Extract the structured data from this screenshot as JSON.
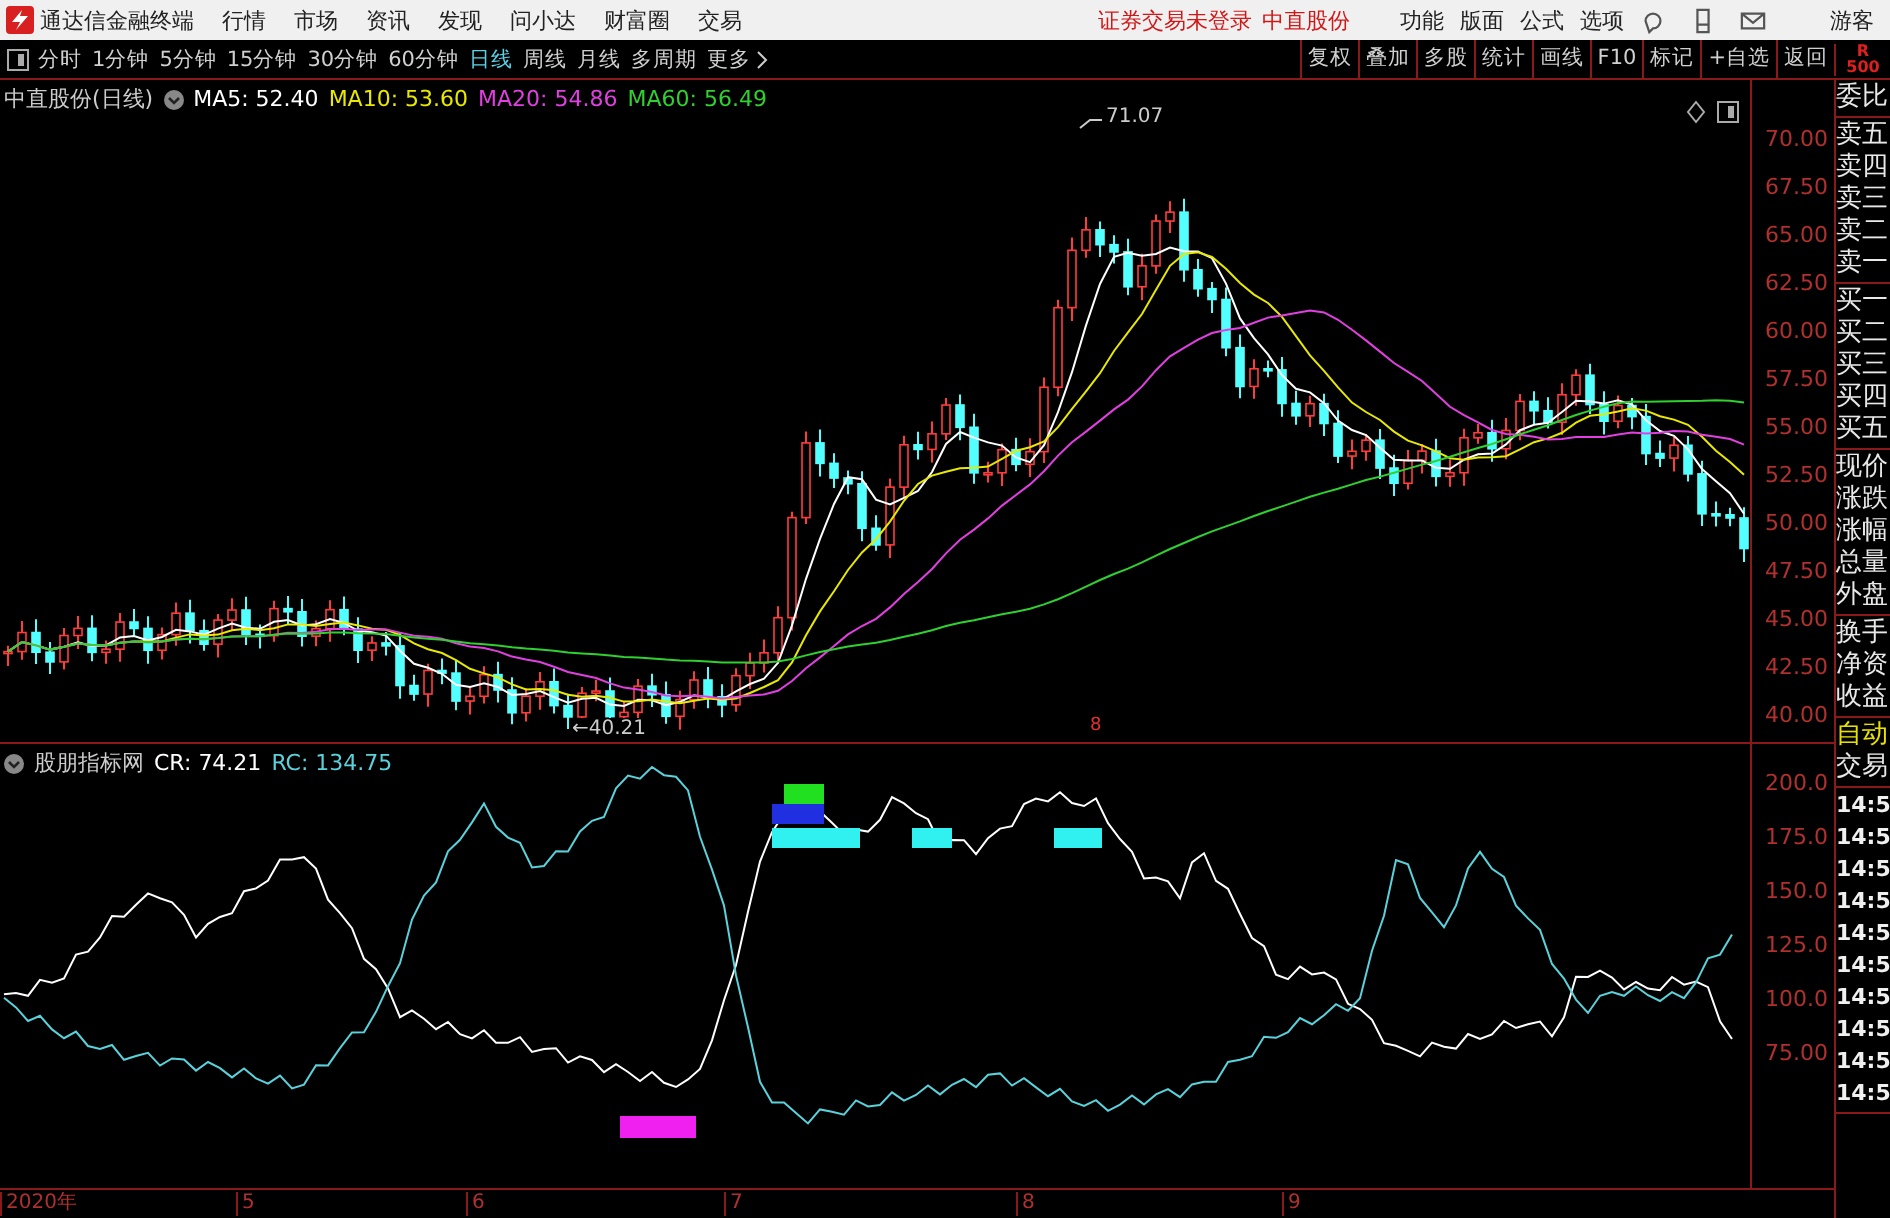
{
  "app": {
    "title": "通达信金融终端"
  },
  "menu": [
    "行情",
    "市场",
    "资讯",
    "发现",
    "问小达",
    "财富圈",
    "交易"
  ],
  "login_status": "证券交易未登录",
  "stock_name": "中直股份",
  "menu_right": [
    "功能",
    "版面",
    "公式",
    "选项"
  ],
  "user": "游客",
  "periods": [
    {
      "label": "分时",
      "selected": false
    },
    {
      "label": "1分钟",
      "selected": false
    },
    {
      "label": "5分钟",
      "selected": false
    },
    {
      "label": "15分钟",
      "selected": false
    },
    {
      "label": "30分钟",
      "selected": false
    },
    {
      "label": "60分钟",
      "selected": false
    },
    {
      "label": "日线",
      "selected": true
    },
    {
      "label": "周线",
      "selected": false
    },
    {
      "label": "月线",
      "selected": false
    },
    {
      "label": "多周期",
      "selected": false
    }
  ],
  "more": "更多",
  "tools": [
    "复权",
    "叠加",
    "多股",
    "统计",
    "画线",
    "F10",
    "标记",
    "+自选",
    "返回"
  ],
  "corner_badge": [
    "R",
    "500"
  ],
  "price_chart": {
    "legend_title": "中直股份(日线)",
    "ma": [
      {
        "label": "MA5: 52.40",
        "color": "#ffffff"
      },
      {
        "label": "MA10: 53.60",
        "color": "#e8e800"
      },
      {
        "label": "MA20: 54.86",
        "color": "#e040e0"
      },
      {
        "label": "MA60: 56.49",
        "color": "#30d030"
      }
    ],
    "yticks": [
      "70.00",
      "67.50",
      "65.00",
      "62.50",
      "60.00",
      "57.50",
      "55.00",
      "52.50",
      "50.00",
      "47.50",
      "45.00",
      "42.50",
      "40.00"
    ],
    "high_label": "71.07",
    "low_label": "←40.21",
    "marker": "8"
  },
  "indicator": {
    "legend_title": "股朋指标网",
    "lines": [
      {
        "label": "CR: 74.21",
        "color": "#ffffff"
      },
      {
        "label": "RC: 134.75",
        "color": "#5ad2dc"
      }
    ],
    "yticks": [
      "200.0",
      "175.0",
      "150.0",
      "125.0",
      "100.0",
      "75.00"
    ]
  },
  "dates": [
    "2020年",
    "5",
    "6",
    "7",
    "8",
    "9"
  ],
  "quote_groups": [
    [
      {
        "label": "委比",
        "kind": "plain"
      }
    ],
    [
      {
        "label": "卖五",
        "kind": "plain"
      },
      {
        "label": "卖四",
        "kind": "plain"
      },
      {
        "label": "卖三",
        "kind": "plain"
      },
      {
        "label": "卖二",
        "kind": "plain"
      },
      {
        "label": "卖一",
        "kind": "plain"
      }
    ],
    [
      {
        "label": "买一",
        "kind": "plain"
      },
      {
        "label": "买二",
        "kind": "plain"
      },
      {
        "label": "买三",
        "kind": "plain"
      },
      {
        "label": "买四",
        "kind": "plain"
      },
      {
        "label": "买五",
        "kind": "plain"
      }
    ],
    [
      {
        "label": "现价",
        "kind": "plain"
      },
      {
        "label": "涨跌",
        "kind": "plain"
      },
      {
        "label": "涨幅",
        "kind": "plain"
      },
      {
        "label": "总量",
        "kind": "plain"
      },
      {
        "label": "外盘",
        "kind": "plain"
      }
    ],
    [
      {
        "label": "换手",
        "kind": "plain"
      },
      {
        "label": "净资",
        "kind": "plain"
      },
      {
        "label": "收益",
        "kind": "plain"
      }
    ],
    [
      {
        "label": "自动",
        "kind": "highlight"
      },
      {
        "label": "交易",
        "kind": "plain"
      }
    ],
    [
      {
        "label": "14:5",
        "kind": "time"
      },
      {
        "label": "14:5",
        "kind": "time"
      },
      {
        "label": "14:5",
        "kind": "time"
      },
      {
        "label": "14:5",
        "kind": "time"
      },
      {
        "label": "14:5",
        "kind": "time"
      },
      {
        "label": "14:5",
        "kind": "time"
      },
      {
        "label": "14:5",
        "kind": "time"
      },
      {
        "label": "14:5",
        "kind": "time"
      },
      {
        "label": "14:5",
        "kind": "time"
      },
      {
        "label": "14:5",
        "kind": "time"
      }
    ]
  ]
}
